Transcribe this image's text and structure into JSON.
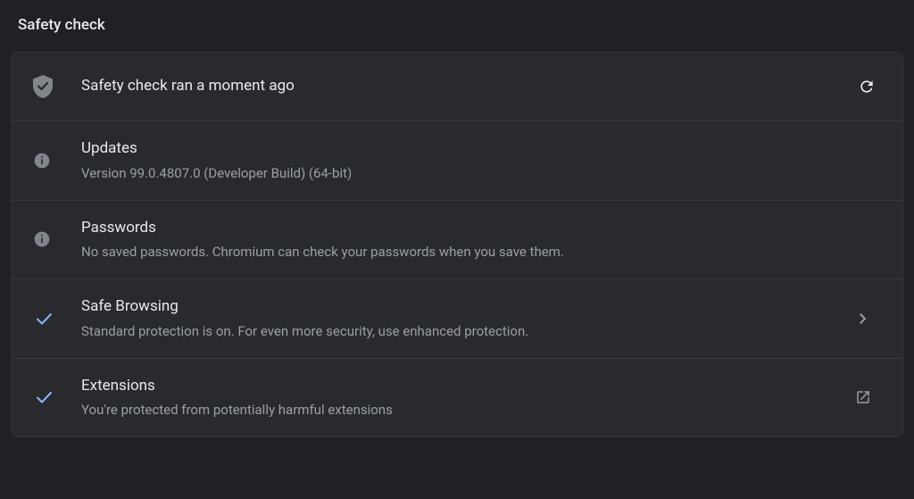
{
  "section_title": "Safety check",
  "header": {
    "title": "Safety check ran a moment ago"
  },
  "items": [
    {
      "title": "Updates",
      "subtitle": "Version 99.0.4807.0 (Developer Build) (64-bit)"
    },
    {
      "title": "Passwords",
      "subtitle": "No saved passwords. Chromium can check your passwords when you save them."
    },
    {
      "title": "Safe Browsing",
      "subtitle": "Standard protection is on. For even more security, use enhanced protection."
    },
    {
      "title": "Extensions",
      "subtitle": "You're protected from potentially harmful extensions"
    }
  ]
}
